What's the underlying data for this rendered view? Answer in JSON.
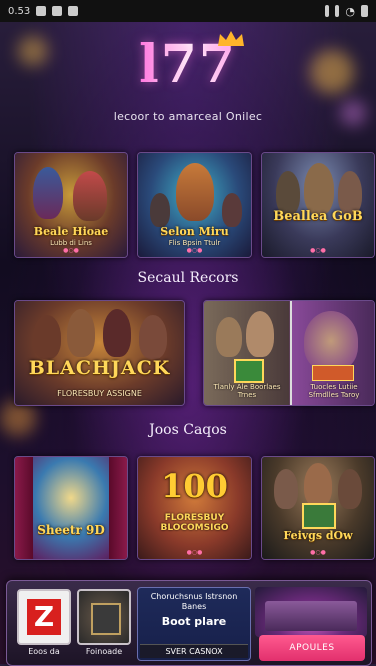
{
  "status_bar": {
    "time": "0.53",
    "left_icons": [
      "image-icon",
      "card-icon",
      "box-icon"
    ],
    "right_icons": [
      "signal-icon",
      "alert-icon",
      "wifi-icon",
      "battery-icon"
    ]
  },
  "header": {
    "logo_text": "l77",
    "tagline": "lecoor to amarceal Onilec"
  },
  "sections": [
    {
      "title": "",
      "cards": [
        {
          "label": "Beale Hioae",
          "sub": "Lubb di Lins"
        },
        {
          "label": "Selon Miru",
          "sub": "Flis Bpsin Ttulr"
        },
        {
          "label": "Beallea GoB",
          "sub": ""
        }
      ]
    },
    {
      "title": "Secaul Recors",
      "cards": [
        {
          "label": "BLACHJACK",
          "sub": "FLORESBUY ASSIGNE"
        },
        {
          "label": "",
          "sub": "Tlanly Ale Boorlaes Trnes"
        },
        {
          "label": "",
          "sub": "Tuocles Lutiie Sfmdlles Taroy"
        }
      ]
    },
    {
      "title": "Joos Caqos",
      "cards": [
        {
          "label": "Sheetr 9D",
          "sub": ""
        },
        {
          "label": "100",
          "sub": "FLORESBUY BLOCOMSIGO"
        },
        {
          "label": "Feivgs dOw",
          "sub": ""
        }
      ]
    }
  ],
  "bottom_bar": {
    "tiles": [
      {
        "label": "Eoos da"
      },
      {
        "label": "Foinoade"
      }
    ],
    "promo": {
      "line1": "Choruchsnus Istrsnon Banes",
      "line2": "Boot plare",
      "line3": "SVER CASNOX"
    },
    "cta_label": "APOULES"
  },
  "colors": {
    "accent_pink": "#e2306d",
    "gold": "#ffd85a",
    "background": "#120c20"
  }
}
